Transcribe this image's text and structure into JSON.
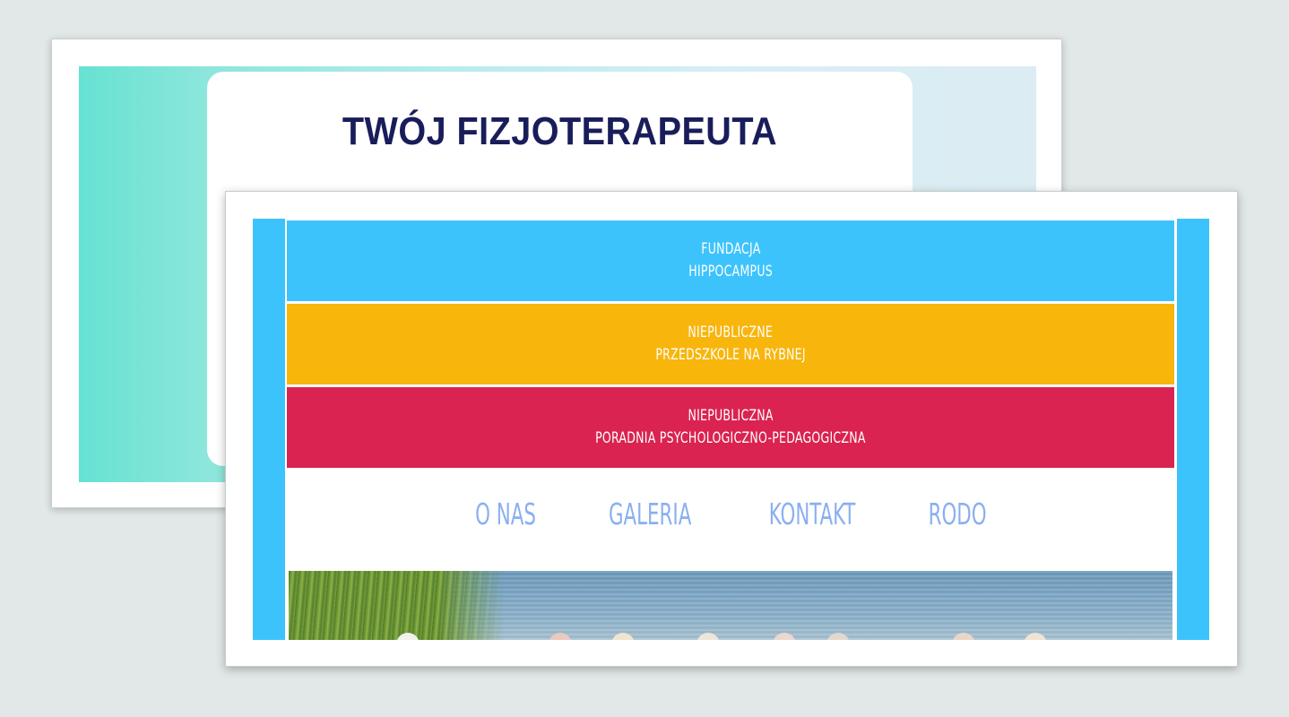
{
  "back_card": {
    "title": "TWÓJ FIZJOTERAPEUTA"
  },
  "front_card": {
    "bands": [
      {
        "line1": "FUNDACJA",
        "line2": "HIPPOCAMPUS",
        "color": "#3dc3fc"
      },
      {
        "line1": "NIEPUBLICZNE",
        "line2": "PRZEDSZKOLE NA RYBNEJ",
        "color": "#f8b50c"
      },
      {
        "line1": "NIEPUBLICZNA",
        "line2": "PORADNIA PSYCHOLOGICZNO-PEDAGOGICZNA",
        "color": "#da2350"
      }
    ],
    "nav": [
      {
        "label": "O NAS"
      },
      {
        "label": "GALERIA"
      },
      {
        "label": "KONTAKT"
      },
      {
        "label": "RODO"
      }
    ],
    "accent_color": "#3dc3fc",
    "nav_color": "#8aaff0"
  },
  "background_color": "#e2e8e8"
}
